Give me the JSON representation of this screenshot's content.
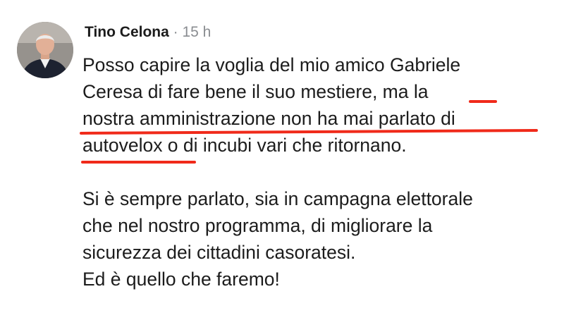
{
  "post": {
    "author": "Tino Celona",
    "separator": " · ",
    "time": "15 h",
    "paragraphs": [
      {
        "lines": [
          "Posso capire la voglia del mio amico Gabriele",
          "Ceresa di fare bene il suo mestiere, ma la",
          "nostra amministrazione non ha mai parlato di",
          "autovelox o di incubi vari che ritornano."
        ]
      },
      {
        "lines": [
          "Si è sempre parlato, sia in campagna elettorale",
          "che nel nostro programma, di migliorare la",
          "sicurezza dei cittadini casoratesi.",
          "Ed è quello che faremo!"
        ]
      }
    ]
  },
  "annotation": {
    "color": "#f02a1a",
    "icon": "red-underline-marks"
  }
}
